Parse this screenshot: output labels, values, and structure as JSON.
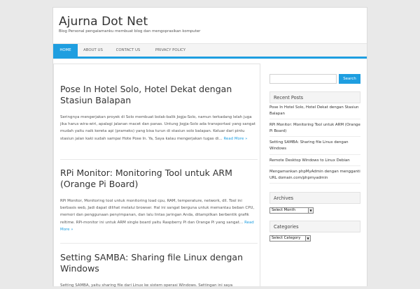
{
  "site": {
    "title": "Ajurna Dot Net",
    "description": "Blog Personal pengalamanku membuat blog dan mengoprasikan komputer"
  },
  "nav": {
    "items": [
      {
        "label": "HOME",
        "active": true
      },
      {
        "label": "ABOUT US",
        "active": false
      },
      {
        "label": "CONTACT US",
        "active": false
      },
      {
        "label": "PRIVACY POLICY",
        "active": false
      }
    ]
  },
  "posts": [
    {
      "title": "Pose In Hotel Solo, Hotel Dekat dengan Stasiun Balapan",
      "excerpt": "Seringnya mengerjakan proyek di Solo membuat bolak-balik Jogja-Solo, namun terkadang lelah juga jika harus wira-wiri, apalagi jalanan macet dan panas. Untung Jogja-Solo ada transportasi yang sangat mudah yaitu naik kereta api (prameks) yang bisa turun di stasiun solo balapan. Keluar dari pintu stasiun jalan kaki sudah sampai Hote Pose In. Ya, Saya kalau mengerjakan tugas di…",
      "read_more": "Read More »"
    },
    {
      "title": "RPi Monitor: Monitoring Tool untuk ARM (Orange Pi Board)",
      "excerpt": "RPi Monitor, Monitoring tool untuk monitoring load cpu, RAM, temperature, network, dll. Tool ini berbasis web, Jadi dapat dilihat melalui browser. Hal ini sangat berguna untuk memantau beban CPU, memori dan penggunaan penyimpanan, dan lalu lintas jaringan Anda, ditampilkan berbentik grafik reltime. RPi-monitor ini untuk ARM single board yaitu Raspberry Pi dan Orange Pi yang sangat…",
      "read_more": "Read More »"
    },
    {
      "title": "Setting SAMBA: Sharing file Linux dengan Windows",
      "excerpt": "Setting SAMBA, yaitu sharing file dari Linux ke sistem operasi Windows. Settingan ini saya",
      "read_more": ""
    }
  ],
  "sidebar": {
    "search_button": "Search",
    "recent_posts_title": "Recent Posts",
    "recent_posts": [
      "Pose In Hotel Solo, Hotel Dekat dengan Stasiun Balapan",
      "RPi Monitor: Monitoring Tool untuk ARM (Orange Pi Board)",
      "Setting SAMBA: Sharing file Linux dengan Windows",
      "Remote Desktop Windows to Linux Debian",
      "Mengamankan phpMyAdmin dengan mengganti URL domain.com/phpmyadmin"
    ],
    "archives_title": "Archives",
    "archives_select": "Select Month",
    "categories_title": "Categories",
    "categories_select": "Select Category"
  },
  "colors": {
    "accent": "#1e9ee0",
    "background": "#e9e9e9"
  }
}
